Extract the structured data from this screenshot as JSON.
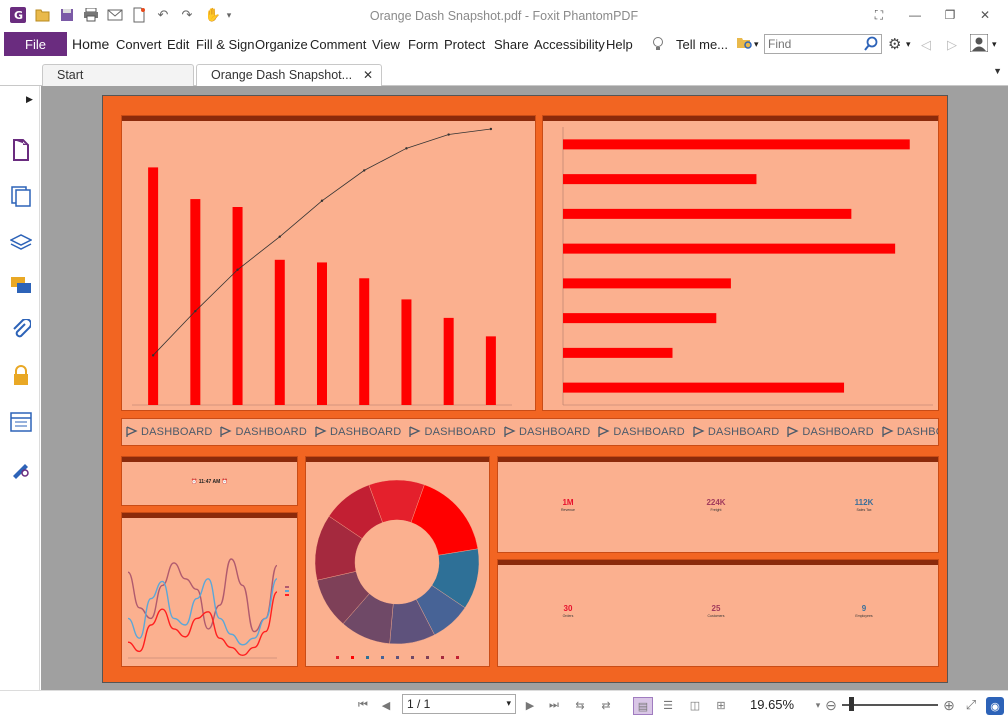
{
  "window": {
    "title": "Orange Dash Snapshot.pdf - Foxit PhantomPDF"
  },
  "menu": {
    "file": "File",
    "items": [
      "Home",
      "Convert",
      "Edit",
      "Fill & Sign",
      "Organize",
      "Comment",
      "View",
      "Form",
      "Protect",
      "Share",
      "Accessibility",
      "Help"
    ],
    "tell_me": "Tell me...",
    "find_placeholder": "Find"
  },
  "tabs": [
    {
      "label": "Start"
    },
    {
      "label": "Orange Dash Snapshot..."
    }
  ],
  "dashboard": {
    "banner_word": "DASHBOARD",
    "banner_repeat": 10,
    "clock": "11:47 AM",
    "kpis_top": [
      {
        "value": "1M",
        "label": "Revenue",
        "color": "#e8112d"
      },
      {
        "value": "224K",
        "label": "Freight",
        "color": "#a23b5c"
      },
      {
        "value": "112K",
        "label": "Sales Tax",
        "color": "#3a6f9a"
      }
    ],
    "kpis_bottom": [
      {
        "value": "30",
        "label": "Orders",
        "color": "#e8112d"
      },
      {
        "value": "25",
        "label": "Customers",
        "color": "#a23b5c"
      },
      {
        "value": "9",
        "label": "Employees",
        "color": "#3a6f9a"
      }
    ]
  },
  "chart_data": [
    {
      "type": "bar",
      "note": "combo chart: bars + cumulative line",
      "values": [
        90,
        78,
        75,
        55,
        54,
        48,
        40,
        33,
        26
      ],
      "line": [
        18,
        34,
        49,
        61,
        74,
        85,
        93,
        98,
        100
      ]
    },
    {
      "type": "bar",
      "orientation": "horizontal",
      "values": [
        95,
        53,
        79,
        91,
        46,
        42,
        30,
        77
      ]
    },
    {
      "type": "pie",
      "donut": true,
      "values": [
        11,
        17,
        12,
        8,
        9,
        10,
        10,
        13,
        10
      ],
      "colors": [
        "#e4202c",
        "#ff0000",
        "#2e7097",
        "#476396",
        "#5e527c",
        "#6f4967",
        "#7e4058",
        "#a5293e",
        "#c21f33"
      ]
    },
    {
      "type": "line",
      "series": [
        {
          "values": [
            35,
            62,
            70,
            45,
            28,
            40,
            48,
            78,
            60,
            25,
            45,
            80,
            70,
            30
          ],
          "color": "#b05a6e"
        },
        {
          "values": [
            70,
            85,
            55,
            42,
            70,
            75,
            55,
            40,
            70,
            82,
            90,
            85,
            70,
            40
          ],
          "color": "#5ba7d8"
        },
        {
          "values": [
            88,
            95,
            75,
            63,
            78,
            84,
            70,
            65,
            85,
            92,
            98,
            92,
            80,
            50
          ],
          "color": "#ff1f1f"
        }
      ]
    }
  ],
  "statusbar": {
    "page": "1 / 1",
    "zoom": "19.65%"
  },
  "colors": {
    "file_menu": "#6a2c7f",
    "page_bg": "#f26522",
    "panel_bg": "#fbb08f",
    "bar_red": "#ff0000"
  }
}
